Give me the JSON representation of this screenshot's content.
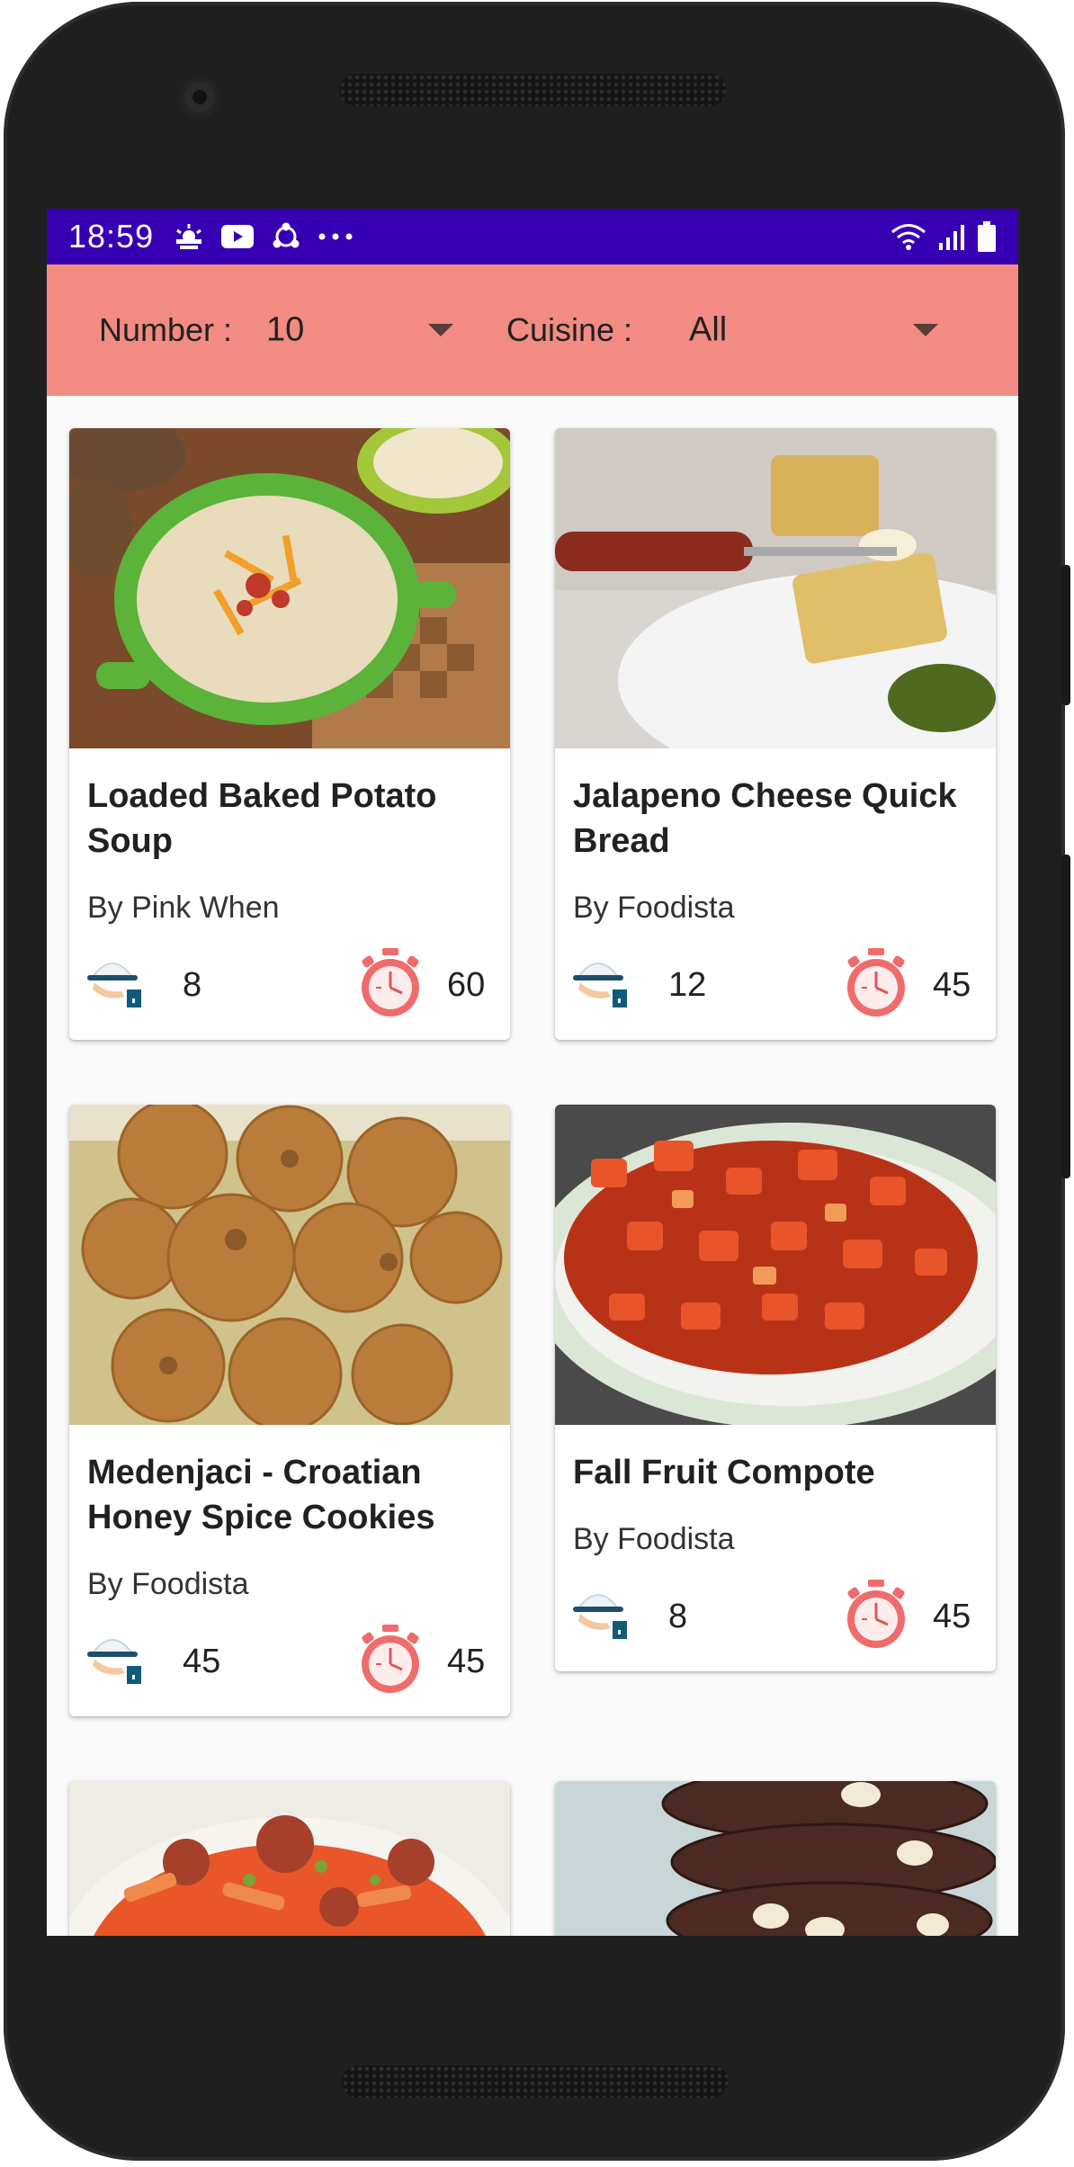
{
  "status_bar": {
    "time": "18:59",
    "left_icons": [
      "weather-icon",
      "youtube-icon",
      "sync-icon",
      "more-dots-icon"
    ],
    "right_icons": [
      "wifi-icon",
      "signal-icon",
      "battery-icon"
    ],
    "background": "#3700b3"
  },
  "filters": {
    "number_label": "Number :",
    "number_value": "10",
    "cuisine_label": "Cuisine :",
    "cuisine_value": "All",
    "background": "#f28b82"
  },
  "recipes": [
    {
      "title": "Loaded Baked Potato Soup",
      "author": "By Pink When",
      "servings": "8",
      "minutes": "60",
      "image": "potato-soup"
    },
    {
      "title": "Jalapeno Cheese Quick Bread",
      "author": "By Foodista",
      "servings": "12",
      "minutes": "45",
      "image": "quick-bread"
    },
    {
      "title": "Medenjaci - Croatian Honey Spice Cookies",
      "author": "By Foodista",
      "servings": "45",
      "minutes": "45",
      "image": "honey-cookies"
    },
    {
      "title": "Fall Fruit Compote",
      "author": "By Foodista",
      "servings": "8",
      "minutes": "45",
      "image": "fruit-compote"
    },
    {
      "title": "",
      "author": "",
      "servings": "",
      "minutes": "",
      "image": "pasta"
    },
    {
      "title": "",
      "author": "",
      "servings": "",
      "minutes": "",
      "image": "chocolate-cookies"
    }
  ]
}
